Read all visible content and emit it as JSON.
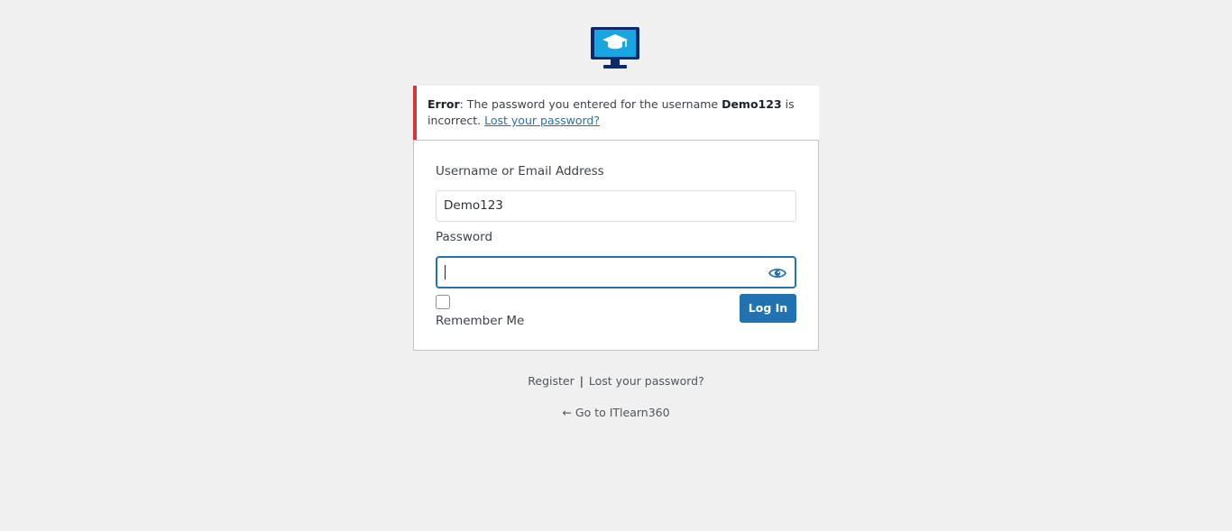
{
  "error": {
    "label": "Error",
    "message_before": ": The password you entered for the username ",
    "username": "Demo123",
    "message_after": " is incorrect. ",
    "lost_link": "Lost your password?"
  },
  "form": {
    "username_label": "Username or Email Address",
    "username_value": "Demo123",
    "password_label": "Password",
    "password_value": "",
    "remember_label": "Remember Me",
    "remember_checked": false,
    "login_button": "Log In"
  },
  "nav": {
    "register": "Register",
    "separator": "|",
    "lost_password": "Lost your password?",
    "back_link": "← Go to ITlearn360"
  },
  "colors": {
    "accent": "#2271b1",
    "error": "#d63638",
    "background": "#f0f0f1"
  },
  "icons": {
    "logo": "monitor-graduation-cap-icon",
    "show_password": "eye-icon"
  }
}
